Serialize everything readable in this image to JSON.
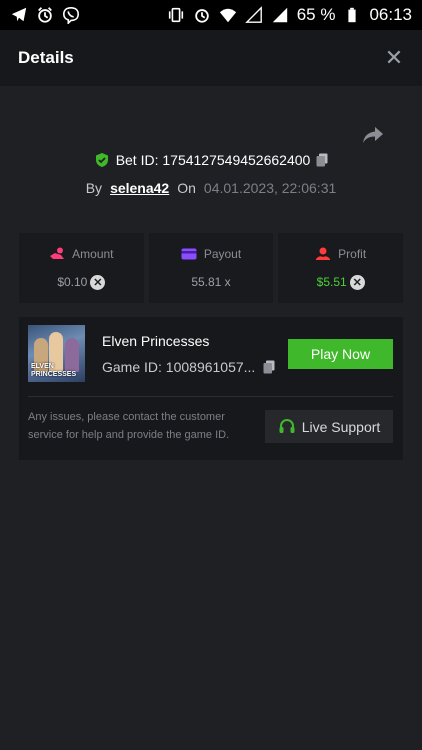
{
  "status_bar": {
    "battery_percent": "65 %",
    "time": "06:13",
    "left_icons": [
      "telegram-icon",
      "alarm-icon",
      "viber-icon"
    ],
    "right_icons": [
      "vibrate-icon",
      "alarm-icon",
      "wifi-icon",
      "signal-empty-icon",
      "signal-icon",
      "battery-icon"
    ]
  },
  "header": {
    "title": "Details",
    "close_icon": "close-icon"
  },
  "bet": {
    "label": "Bet ID: 1754127549452662400",
    "by_label": "By",
    "username": "selena42",
    "on_label": "On",
    "date": "04.01.2023, 22:06:31",
    "accent_color": "#3fb82b"
  },
  "stats": [
    {
      "label": "Amount",
      "value": "$0.10",
      "icon": "amount-icon",
      "icon_color": "#ff3c78"
    },
    {
      "label": "Payout",
      "value": "55.81 x",
      "icon": "payout-card-icon",
      "icon_color": "#8c4dff"
    },
    {
      "label": "Profit",
      "value": "$5.51",
      "icon": "profit-icon",
      "icon_color": "#ff3b3b"
    }
  ],
  "game": {
    "name": "Elven Princesses",
    "game_id": "Game ID: 1008961057...",
    "thumb_text": "ELVEN PRINCESSES",
    "play_label": "Play Now",
    "play_color": "#3fb82b",
    "issues_text": "Any issues, please contact the customer service for help and provide the game ID.",
    "support_label": "Live Support"
  }
}
